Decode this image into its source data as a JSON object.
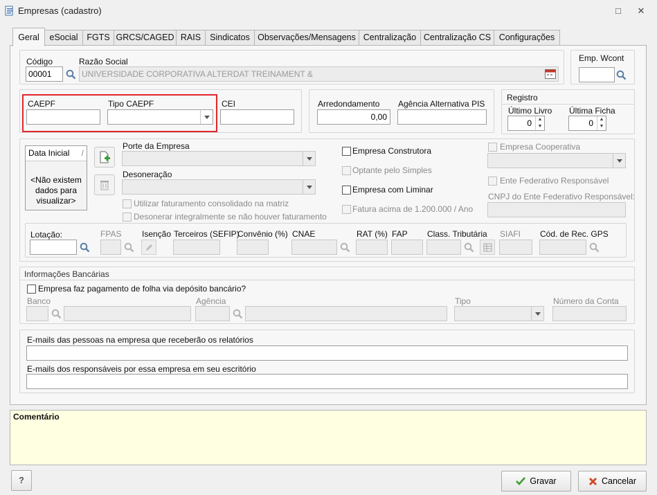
{
  "window": {
    "title": "Empresas (cadastro)"
  },
  "tabs": [
    "Geral",
    "eSocial",
    "FGTS",
    "GRCS/CAGED",
    "RAIS",
    "Sindicatos",
    "Observações/Mensagens",
    "Centralização",
    "Centralização CS",
    "Configurações"
  ],
  "identificacao": {
    "codigo_label": "Código",
    "codigo_value": "00001",
    "razao_label": "Razão Social",
    "razao_value": "UNIVERSIDADE CORPORATIVA ALTERDAT TREINAMENT &",
    "emp_wcont_label": "Emp. Wcont"
  },
  "caepf": {
    "caepf_label": "CAEPF",
    "tipo_label": "Tipo CAEPF",
    "cei_label": "CEI"
  },
  "arredondamento": {
    "label": "Arredondamento",
    "value": "0,00",
    "agencia_pis_label": "Agência Alternativa PIS"
  },
  "registro": {
    "title": "Registro",
    "ultimo_livro_label": "Último Livro",
    "ultimo_livro_value": "0",
    "ultima_ficha_label": "Última Ficha",
    "ultima_ficha_value": "0"
  },
  "data_inicial": {
    "header": "Data Inicial",
    "sort_glyph": "/",
    "empty_text": "<Não existem dados para visualizar>"
  },
  "porte": {
    "porte_label": "Porte da Empresa",
    "desoneracao_label": "Desoneração",
    "faturamento_label": "Utilizar faturamento consolidado na matriz",
    "desonerar_label": "Desonerar integralmente se não houver faturamento"
  },
  "flags": {
    "construtora": "Empresa Construtora",
    "simples": "Optante pelo Simples",
    "liminar": "Empresa com Liminar",
    "fatura": "Fatura acima de 1.200.000 / Ano",
    "cooperativa": "Empresa Cooperativa",
    "ente": "Ente Federativo Responsável",
    "cnpj_ente": "CNPJ do Ente Federativo Responsável:"
  },
  "lotacao": {
    "lotacao": "Lotação:",
    "fpas": "FPAS",
    "isencao": "Isenção",
    "terceiros": "Terceiros (SEFIP)",
    "convenio": "Convênio (%)",
    "cnae": "CNAE",
    "rat": "RAT (%)",
    "fap": "FAP",
    "class_trib": "Class. Tributária",
    "siafi": "SIAFI",
    "cod_rec_gps": "Cód. de Rec. GPS"
  },
  "bancarias": {
    "title": "Informações Bancárias",
    "pagamento": "Empresa faz pagamento de folha via depósito bancário?",
    "banco": "Banco",
    "agencia": "Agência",
    "tipo": "Tipo",
    "numero_conta": "Número da Conta"
  },
  "emails": {
    "relatorios": "E-mails das pessoas na empresa que receberão os relatórios",
    "responsaveis": "E-mails dos responsáveis por essa empresa em seu escritório"
  },
  "comentario": {
    "label": "Comentário"
  },
  "buttons": {
    "help": "?",
    "gravar": "Gravar",
    "cancelar": "Cancelar"
  },
  "colors": {
    "highlight": "#e0262a",
    "comment_bg": "#ffffe1",
    "search_icon": "#5a7fa8"
  }
}
